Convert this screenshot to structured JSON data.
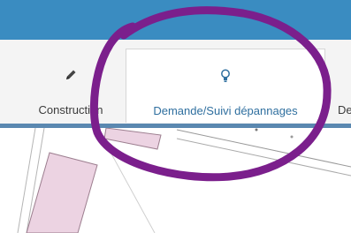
{
  "toolbar": {
    "tabs": [
      {
        "label": "Construction",
        "icon": "pencil-icon",
        "active": false
      },
      {
        "label": "Demande/Suivi dépannages",
        "icon": "lightbulb-icon",
        "active": true
      },
      {
        "label": "De",
        "icon": "",
        "active": false
      }
    ]
  },
  "colors": {
    "topbar": "#3a8cc1",
    "active_label": "#2f6f9f",
    "annotation": "#7b1f8c",
    "parcel_fill": "#ecd3e2"
  }
}
